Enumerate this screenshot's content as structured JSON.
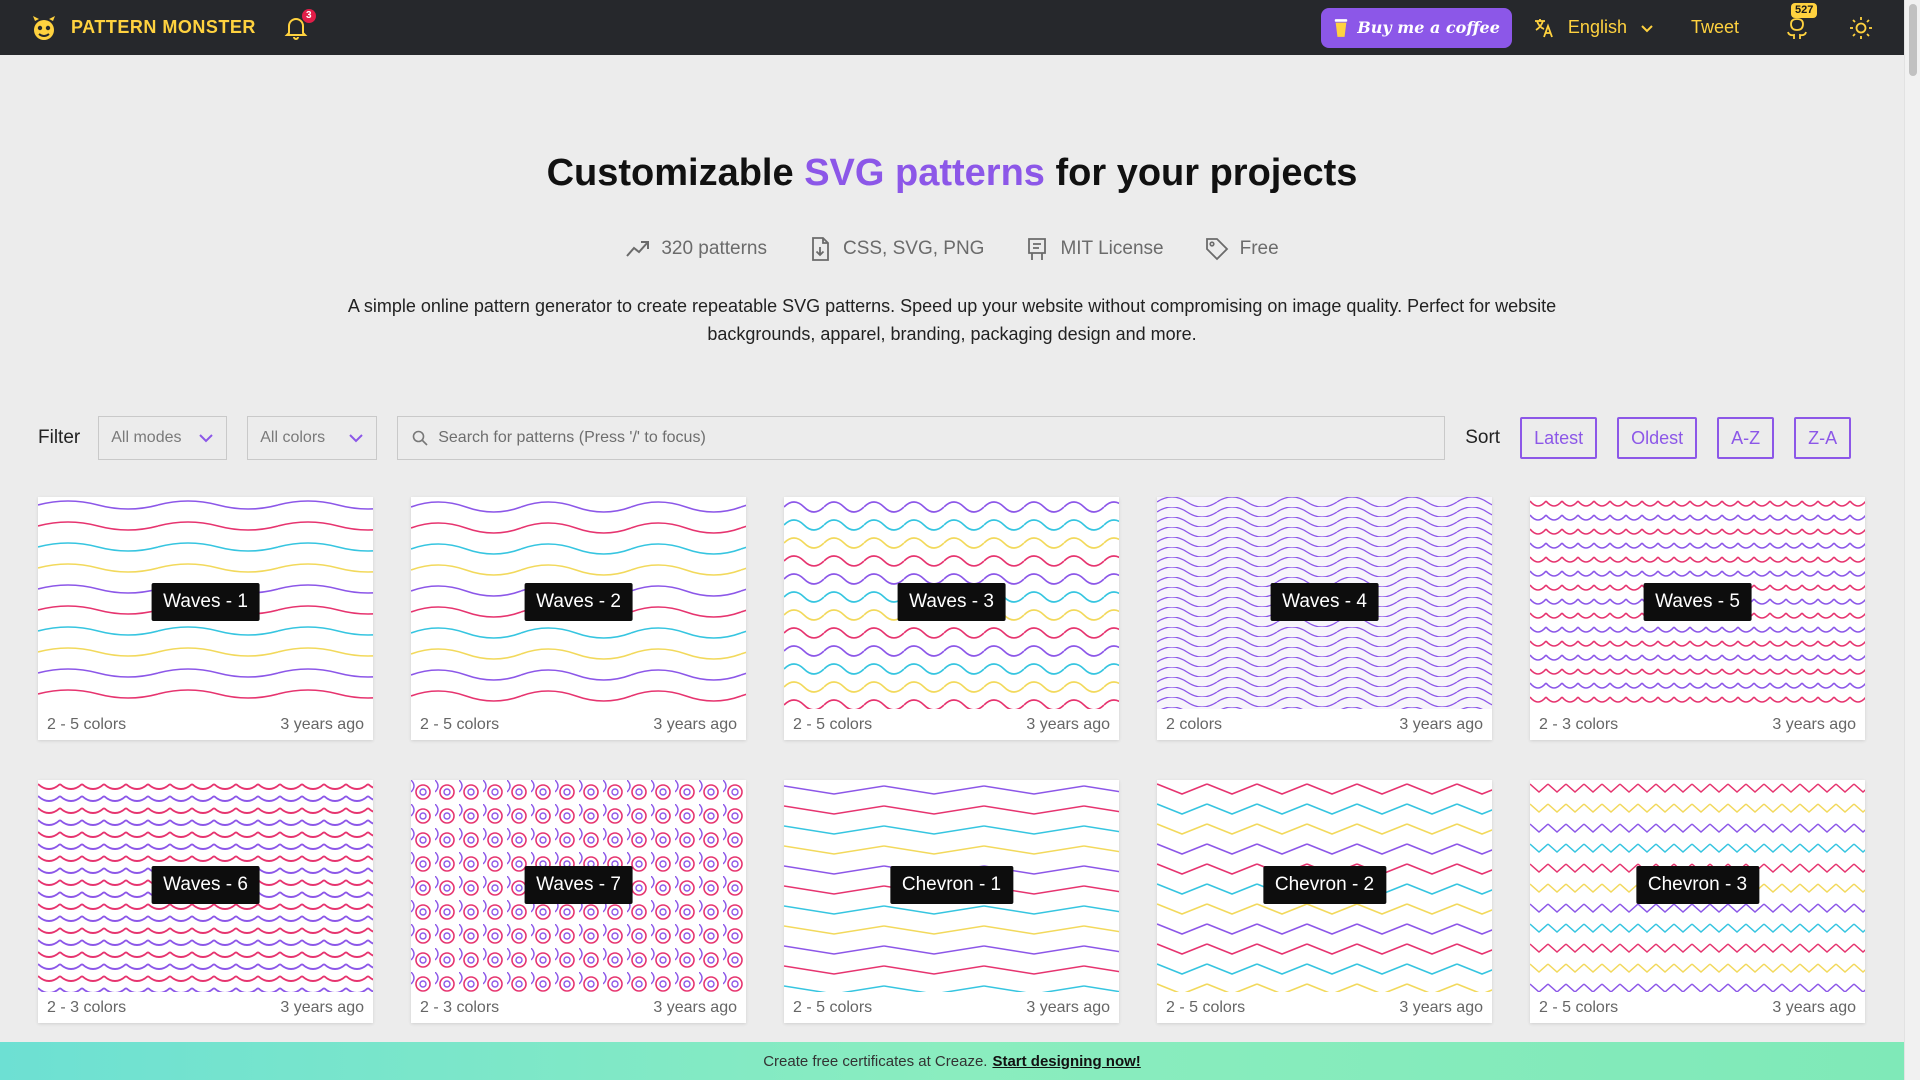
{
  "nav": {
    "brand": "PATTERN MONSTER",
    "notifications_count": "3",
    "coffee_label": "Buy me a coffee",
    "language": "English",
    "tweet": "Tweet",
    "github_stars": "527",
    "brand_color": "#ffd23f",
    "accent_color": "#8c57e8"
  },
  "hero": {
    "title_pre": "Customizable ",
    "title_accent": "SVG patterns",
    "title_post": " for your projects",
    "stats": [
      "320 patterns",
      "CSS, SVG, PNG",
      "MIT License",
      "Free"
    ],
    "description": "A simple online pattern generator to create repeatable SVG patterns. Speed up your website without compromising on image quality. Perfect for website backgrounds, apparel, branding, packaging design and more."
  },
  "filter": {
    "label": "Filter",
    "modes": "All modes",
    "colors": "All colors",
    "search_placeholder": "Search for patterns (Press '/' to focus)",
    "sort_label": "Sort",
    "sort_options": [
      "Latest",
      "Oldest",
      "A-Z",
      "Z-A"
    ]
  },
  "patterns": [
    {
      "name": "Waves - 1",
      "colors": "2 - 5 colors",
      "age": "3 years ago"
    },
    {
      "name": "Waves - 2",
      "colors": "2 - 5 colors",
      "age": "3 years ago"
    },
    {
      "name": "Waves - 3",
      "colors": "2 - 5 colors",
      "age": "3 years ago"
    },
    {
      "name": "Waves - 4",
      "colors": "2 colors",
      "age": "3 years ago"
    },
    {
      "name": "Waves - 5",
      "colors": "2 - 3 colors",
      "age": "3 years ago"
    },
    {
      "name": "Waves - 6",
      "colors": "2 - 3 colors",
      "age": "3 years ago"
    },
    {
      "name": "Waves - 7",
      "colors": "2 - 3 colors",
      "age": "3 years ago"
    },
    {
      "name": "Chevron - 1",
      "colors": "2 - 5 colors",
      "age": "3 years ago"
    },
    {
      "name": "Chevron - 2",
      "colors": "2 - 5 colors",
      "age": "3 years ago"
    },
    {
      "name": "Chevron - 3",
      "colors": "2 - 5 colors",
      "age": "3 years ago"
    }
  ],
  "banner": {
    "text": "Create free certificates at Creaze.",
    "link": "Start designing now!"
  }
}
